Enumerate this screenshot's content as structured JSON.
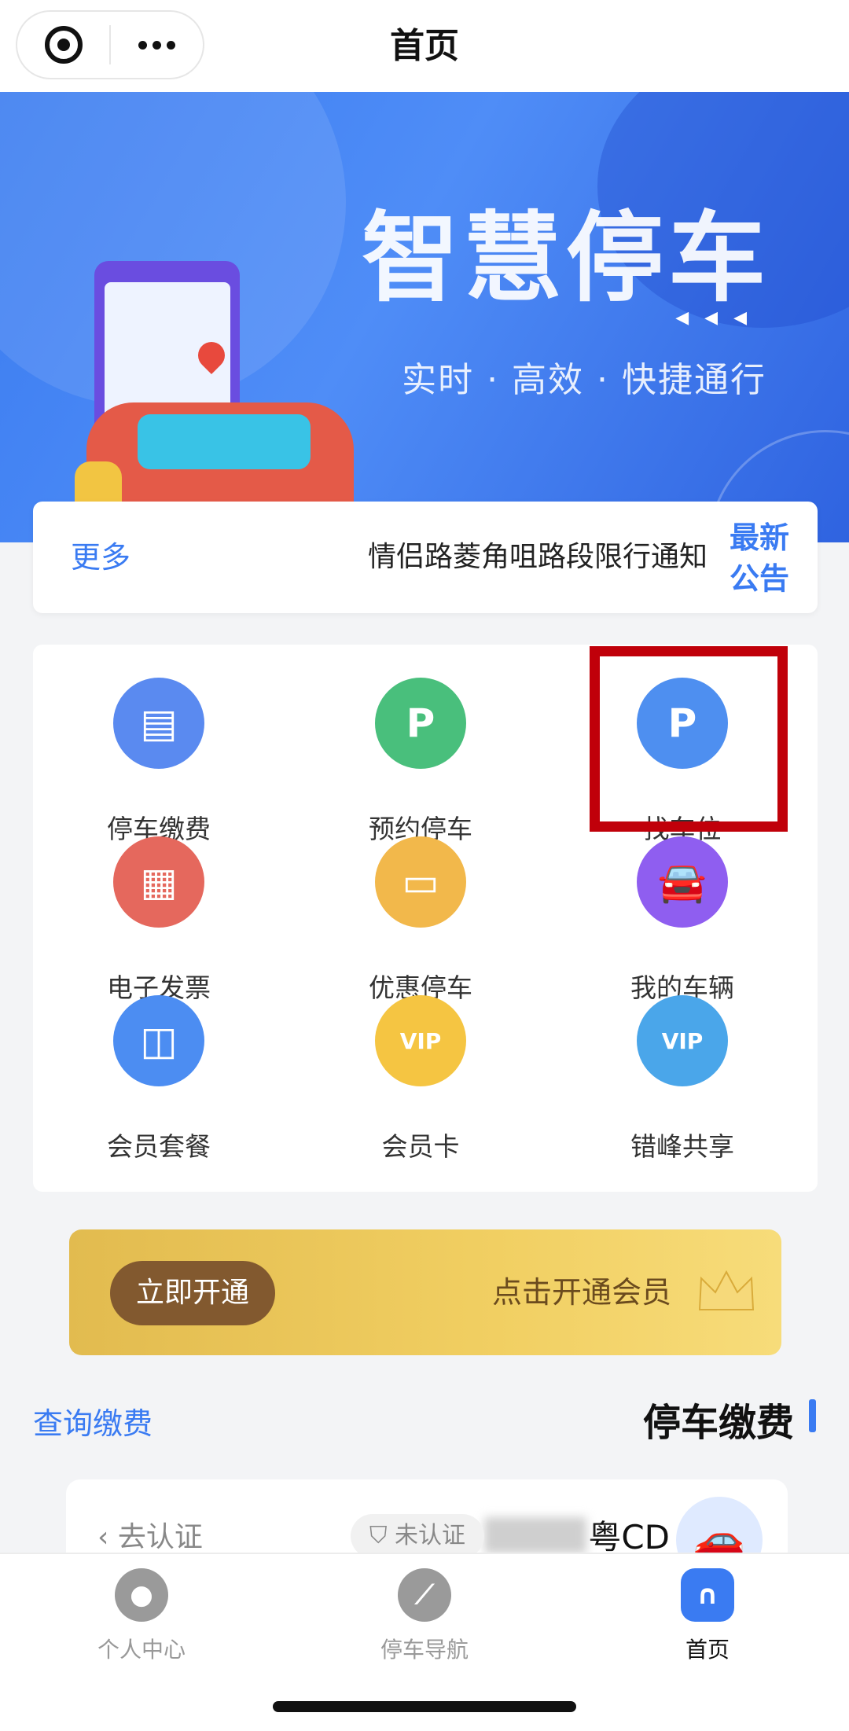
{
  "header": {
    "title": "首页",
    "capsule_left_icon": "target-icon",
    "capsule_right_icon": "more-dots-icon"
  },
  "banner": {
    "title": "智慧停车",
    "subtitle": "实时 · 高效 · 快捷通行",
    "slide_count": 2,
    "active_slide": 2
  },
  "notice": {
    "tag": "最新公告",
    "text": "情侣路菱角咀路段限行通知",
    "more": "更多"
  },
  "services": [
    {
      "label": "找车位",
      "icon": "parking-icon",
      "glyph": "P",
      "color": "#4e8ff0"
    },
    {
      "label": "预约停车",
      "icon": "reserve-parking-icon",
      "glyph": "P",
      "color": "#49bf7c"
    },
    {
      "label": "停车缴费",
      "icon": "payment-doc-icon",
      "glyph": "▤",
      "color": "#5a8af0"
    },
    {
      "label": "我的车辆",
      "icon": "car-icon",
      "glyph": "🚘",
      "color": "#8f5ef0"
    },
    {
      "label": "优惠停车",
      "icon": "coupon-icon",
      "glyph": "▭",
      "color": "#f2b84b"
    },
    {
      "label": "电子发票",
      "icon": "invoice-icon",
      "glyph": "▦",
      "color": "#e5685d"
    },
    {
      "label": "错峰共享",
      "icon": "vip-card-icon",
      "glyph": "VIP",
      "color": "#4aa6ea"
    },
    {
      "label": "会员卡",
      "icon": "vip-card-yellow-icon",
      "glyph": "VIP",
      "color": "#f5c542"
    },
    {
      "label": "会员套餐",
      "icon": "shopping-bag-icon",
      "glyph": "◫",
      "color": "#4c8df2"
    }
  ],
  "member": {
    "text": "点击开通会员",
    "button": "立即开通",
    "icon": "crown-icon"
  },
  "section": {
    "title": "停车缴费",
    "link": "查询缴费"
  },
  "vehicle": {
    "plate_prefix": "粤CD",
    "badge": "未认证",
    "action": "去认证"
  },
  "tabbar": [
    {
      "label": "首页",
      "icon": "home-icon",
      "active": true
    },
    {
      "label": "停车导航",
      "icon": "compass-icon",
      "active": false
    },
    {
      "label": "个人中心",
      "icon": "user-icon",
      "active": false
    }
  ],
  "colors": {
    "accent": "#3a7bf2",
    "highlight": "#c0000a",
    "member_button": "#82592f"
  }
}
